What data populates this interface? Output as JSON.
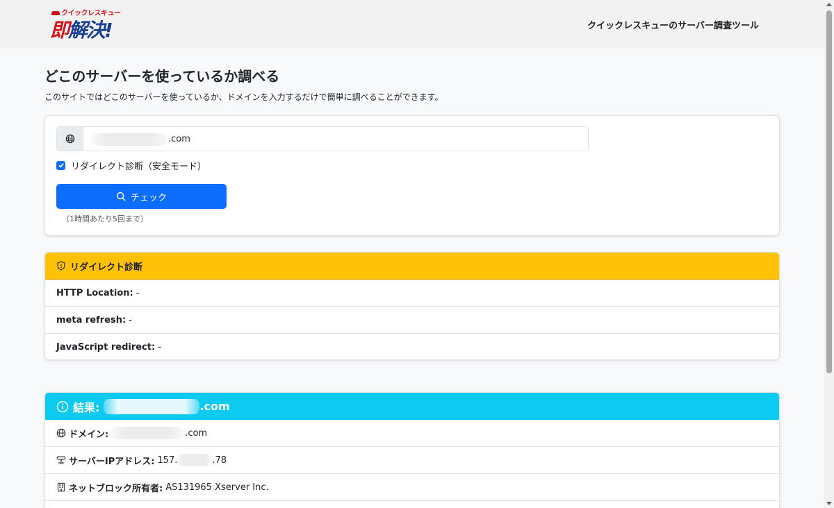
{
  "header": {
    "logo_sub": "クイックレスキュー",
    "logo_main_red": "即",
    "logo_main_blue": "解決!",
    "tool_name": "クイックレスキューのサーバー調査ツール"
  },
  "page": {
    "title": "どこのサーバーを使っているか調べる",
    "description": "このサイトではどこのサーバーを使っているか、ドメインを入力するだけで簡単に調べることができます。"
  },
  "form": {
    "domain_value": ".com",
    "redirect_check_label": "リダイレクト診断（安全モード）",
    "redirect_checked": true,
    "check_button_label": "チェック",
    "rate_limit_hint": "（1時間あたり5回まで）"
  },
  "redirect": {
    "header": "リダイレクト診断",
    "rows": [
      {
        "label": "HTTP Location:",
        "value": "-"
      },
      {
        "label": "meta refresh:",
        "value": "-"
      },
      {
        "label": "JavaScript redirect:",
        "value": "-"
      }
    ]
  },
  "result": {
    "header_label": "結果:",
    "header_domain_suffix": ".com",
    "domain_label": "ドメイン:",
    "domain_suffix": ".com",
    "ip_label": "サーバーIPアドレス:",
    "ip_prefix": "157.",
    "ip_suffix": ".78",
    "netblock_label": "ネットブロック所有者:",
    "netblock_value": "AS131965 Xserver Inc."
  },
  "colors": {
    "primary": "#0d6efd",
    "warning": "#ffc107",
    "info": "#0dcaf0"
  }
}
